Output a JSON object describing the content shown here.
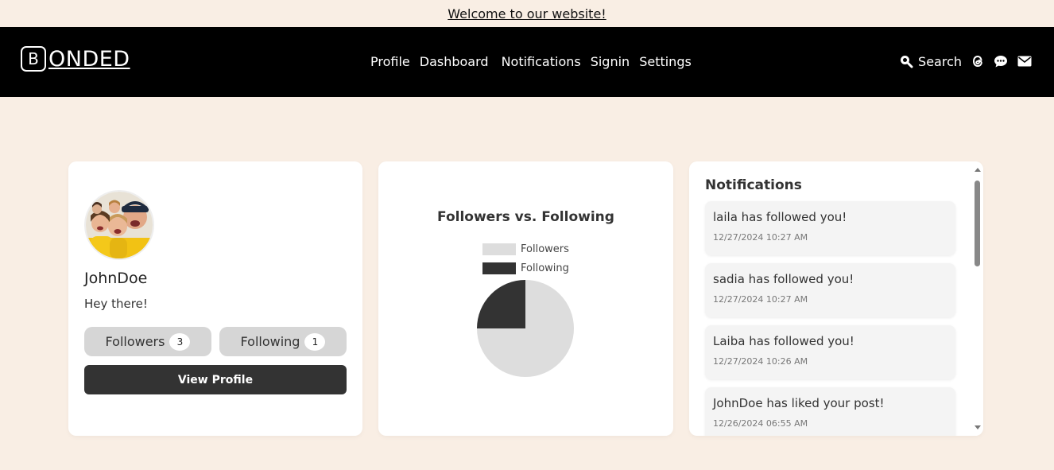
{
  "banner": {
    "text": "Welcome to our website!"
  },
  "brand": {
    "letter": "B",
    "text": "ONDED"
  },
  "nav": {
    "links": [
      "Profile",
      "Dashboard",
      "Notifications",
      "Signin",
      "Settings"
    ],
    "search_label": "Search",
    "icons": [
      "search-icon",
      "threads-icon",
      "chat-icon",
      "mail-icon"
    ]
  },
  "profile": {
    "username": "JohnDoe",
    "bio": "Hey there!",
    "followers_label": "Followers",
    "followers_count": "3",
    "following_label": "Following",
    "following_count": "1",
    "view_button": "View Profile"
  },
  "chart_data": {
    "type": "pie",
    "title": "Followers vs. Following",
    "categories": [
      "Followers",
      "Following"
    ],
    "values": [
      3,
      1
    ],
    "colors": [
      "#dddddd",
      "#333333"
    ],
    "legend": "top"
  },
  "notifications": {
    "title": "Notifications",
    "items": [
      {
        "text": "laila has followed you!",
        "time": "12/27/2024 10:27 AM"
      },
      {
        "text": "sadia has followed you!",
        "time": "12/27/2024 10:27 AM"
      },
      {
        "text": "Laiba has followed you!",
        "time": "12/27/2024 10:26 AM"
      },
      {
        "text": "JohnDoe has liked your post!",
        "time": "12/26/2024 06:55 AM"
      }
    ]
  },
  "colors": {
    "page_bg": "#f9eee4",
    "navbar_bg": "#000000",
    "button_dark": "#333333",
    "pill_bg": "#d6d6d6"
  }
}
